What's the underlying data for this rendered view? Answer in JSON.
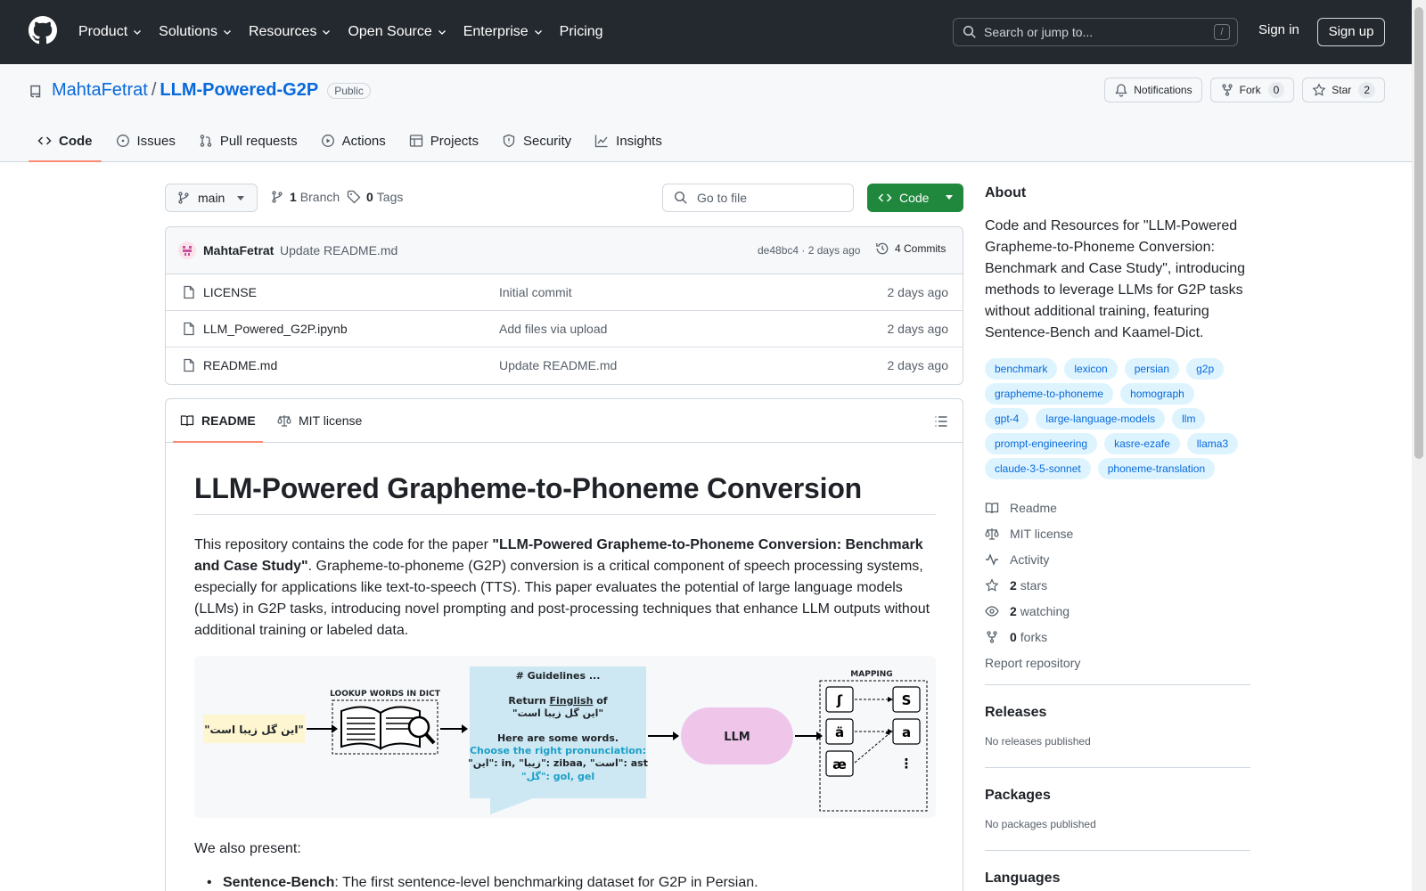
{
  "header": {
    "nav": [
      "Product",
      "Solutions",
      "Resources",
      "Open Source",
      "Enterprise",
      "Pricing"
    ],
    "search_placeholder": "Search or jump to...",
    "search_key": "/",
    "signin": "Sign in",
    "signup": "Sign up"
  },
  "repo": {
    "owner": "MahtaFetrat",
    "sep": "/",
    "name": "LLM-Powered-G2P",
    "visibility": "Public",
    "notifications": "Notifications",
    "fork_label": "Fork",
    "fork_count": "0",
    "star_label": "Star",
    "star_count": "2",
    "tabs": [
      "Code",
      "Issues",
      "Pull requests",
      "Actions",
      "Projects",
      "Security",
      "Insights"
    ]
  },
  "browser": {
    "branch": "main",
    "branch_count": "1",
    "branch_label": "Branch",
    "tag_count": "0",
    "tag_label": "Tags",
    "goto_placeholder": "Go to file",
    "code_label": "Code",
    "commit": {
      "author": "MahtaFetrat",
      "message": "Update README.md",
      "sha_time": "de48bc4 · 2 days ago",
      "commits": "4 Commits"
    },
    "files": [
      {
        "name": "LICENSE",
        "message": "Initial commit",
        "date": "2 days ago"
      },
      {
        "name": "LLM_Powered_G2P.ipynb",
        "message": "Add files via upload",
        "date": "2 days ago"
      },
      {
        "name": "README.md",
        "message": "Update README.md",
        "date": "2 days ago"
      }
    ]
  },
  "readme": {
    "tab_readme": "README",
    "tab_license": "MIT license",
    "title": "LLM-Powered Grapheme-to-Phoneme Conversion",
    "intro_pre": "This repository contains the code for the paper ",
    "intro_bold": "\"LLM-Powered Grapheme-to-Phoneme Conversion: Benchmark and Case Study\"",
    "intro_post": ". Grapheme-to-phoneme (G2P) conversion is a critical component of speech processing systems, especially for applications like text-to-speech (TTS). This paper evaluates the potential of large language models (LLMs) in G2P tasks, introducing novel prompting and post-processing techniques that enhance LLM outputs without additional training or labeled data.",
    "figure": {
      "input_sentence": "\"این گل زیبا است\"",
      "lookup_title": "LOOKUP WORDS IN DICT",
      "guidelines": "# Guidelines ...",
      "return_pre": "Return ",
      "return_word": "Finglish",
      "return_post": " of",
      "quoted": "\"این گل زیبا است\"",
      "here_words": "Here are some words.",
      "choose": "Choose the right pronunciation:",
      "entries": "\"این\": in, \"زیبا\": zibaa, \"است\": ast",
      "gol": "\"گل\": gol, gel",
      "llm": "LLM",
      "mapping": "MAPPING",
      "src_symbols": [
        "ʃ",
        "ä",
        "æ"
      ],
      "dst_symbols": [
        "S",
        "a",
        "⋮"
      ]
    },
    "also": "We also present:",
    "bullet_bold": "Sentence-Bench",
    "bullet_text": ": The first sentence-level benchmarking dataset for G2P in Persian."
  },
  "sidebar": {
    "about": "About",
    "description": "Code and Resources for \"LLM-Powered Grapheme-to-Phoneme Conversion: Benchmark and Case Study\", introducing methods to leverage LLMs for G2P tasks without additional training, featuring Sentence-Bench and Kaamel-Dict.",
    "topics": [
      "benchmark",
      "lexicon",
      "persian",
      "g2p",
      "grapheme-to-phoneme",
      "homograph",
      "gpt-4",
      "large-language-models",
      "llm",
      "prompt-engineering",
      "kasre-ezafe",
      "llama3",
      "claude-3-5-sonnet",
      "phoneme-translation"
    ],
    "readme": "Readme",
    "license": "MIT license",
    "activity": "Activity",
    "stars_count": "2",
    "stars_label": "stars",
    "watching_count": "2",
    "watching_label": "watching",
    "forks_count": "0",
    "forks_label": "forks",
    "report": "Report repository",
    "releases": "Releases",
    "no_releases": "No releases published",
    "packages": "Packages",
    "no_packages": "No packages published",
    "languages": "Languages"
  }
}
